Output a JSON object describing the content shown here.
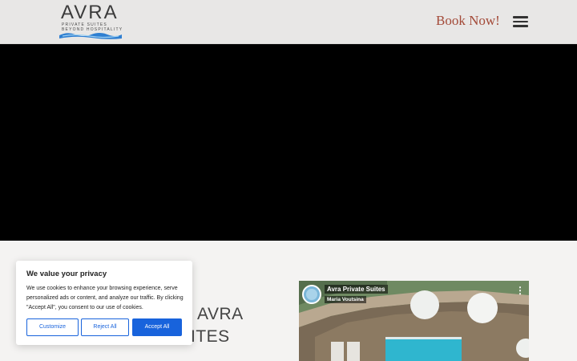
{
  "header": {
    "logo": {
      "title": "AVRA",
      "subtitle_line1": "PRIVATE SUITES",
      "subtitle_line2": "BEYOND HOSPITALITY"
    },
    "book_now_label": "Book Now!",
    "menu_icon": "hamburger-menu-icon"
  },
  "section": {
    "title_line1": "AVRA",
    "title_line2": "ITES"
  },
  "video_embed": {
    "title": "Avra Private Suites",
    "channel": "Maria Voutsina",
    "more_icon": "more-vertical-icon"
  },
  "cookie_banner": {
    "title": "We value your privacy",
    "text": "We use cookies to enhance your browsing experience, serve personalized ads or content, and analyze our traffic. By clicking \"Accept All\", you consent to our use of cookies.",
    "customize_label": "Customize",
    "reject_label": "Reject All",
    "accept_label": "Accept All"
  },
  "colors": {
    "header_bg": "#e8e7e6",
    "book_now": "#a34a38",
    "video_bg": "#000000",
    "page_bg": "#f4f3f2",
    "cookie_accent": "#1863dc"
  }
}
